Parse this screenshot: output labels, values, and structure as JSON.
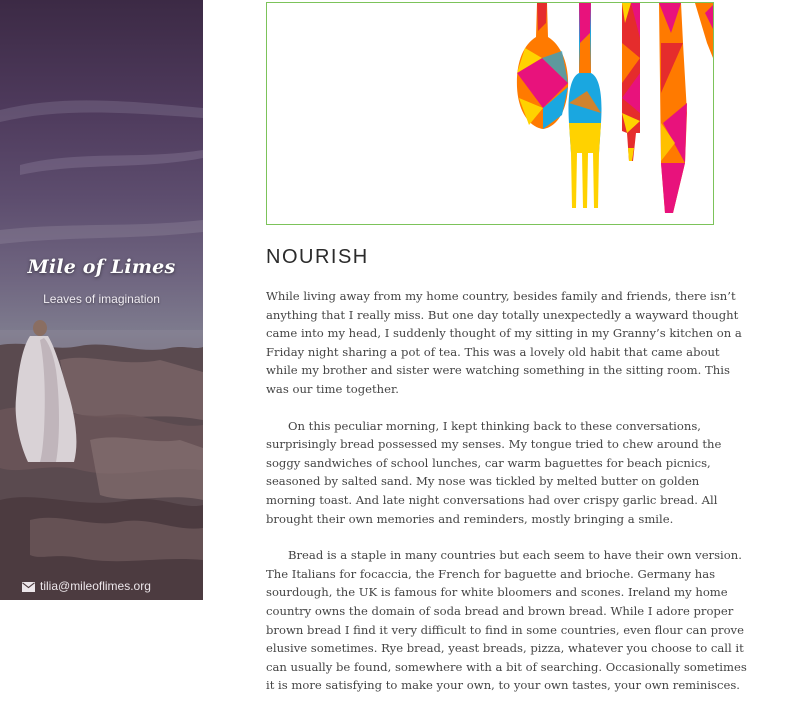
{
  "sidebar": {
    "site_title": "Mile of Limes",
    "tagline": "Leaves of imagination",
    "contact_email": "tilia@mileoflimes.org",
    "contact_icon": "envelope-icon"
  },
  "featured_image": {
    "illustration": "cutlery-illustration",
    "border_color": "#7cc35a",
    "palette": [
      "#e8127c",
      "#ff7a00",
      "#ffd200",
      "#1aa7e0",
      "#e52c2c"
    ]
  },
  "post": {
    "title": "NOURISH",
    "paragraphs": [
      "While living away from my home country, besides family and friends, there isn’t anything that I really miss. But one day totally unexpectedly a wayward thought came into my head, I suddenly thought of my sitting in my Granny’s kitchen on a Friday night sharing a pot of tea. This was a lovely old habit that came about while my brother and sister were watching something in the sitting room. This was our time together.",
      "On this peculiar morning, I kept thinking back to these conversations, surprisingly bread possessed my senses. My tongue tried to chew around the soggy sandwiches of school lunches, car warm baguettes for beach picnics, seasoned by salted sand. My nose was tickled by melted butter on golden morning toast. And late night conversations had over crispy garlic bread. All brought their own memories and reminders, mostly bringing a smile.",
      "Bread is a staple in many countries but each seem to have their own version. The Italians for focaccia, the French for baguette and brioche. Germany has sourdough, the UK is famous for white bloomers and scones. Ireland my home country owns the domain of soda bread and brown bread. While I adore proper brown bread I find it very difficult to find in some countries, even flour can prove elusive sometimes. Rye bread, yeast breads, pizza, whatever you choose to call it can usually be found, somewhere with a bit of searching. Occasionally sometimes it is more satisfying to make your own, to your own tastes, your own reminisces."
    ]
  }
}
